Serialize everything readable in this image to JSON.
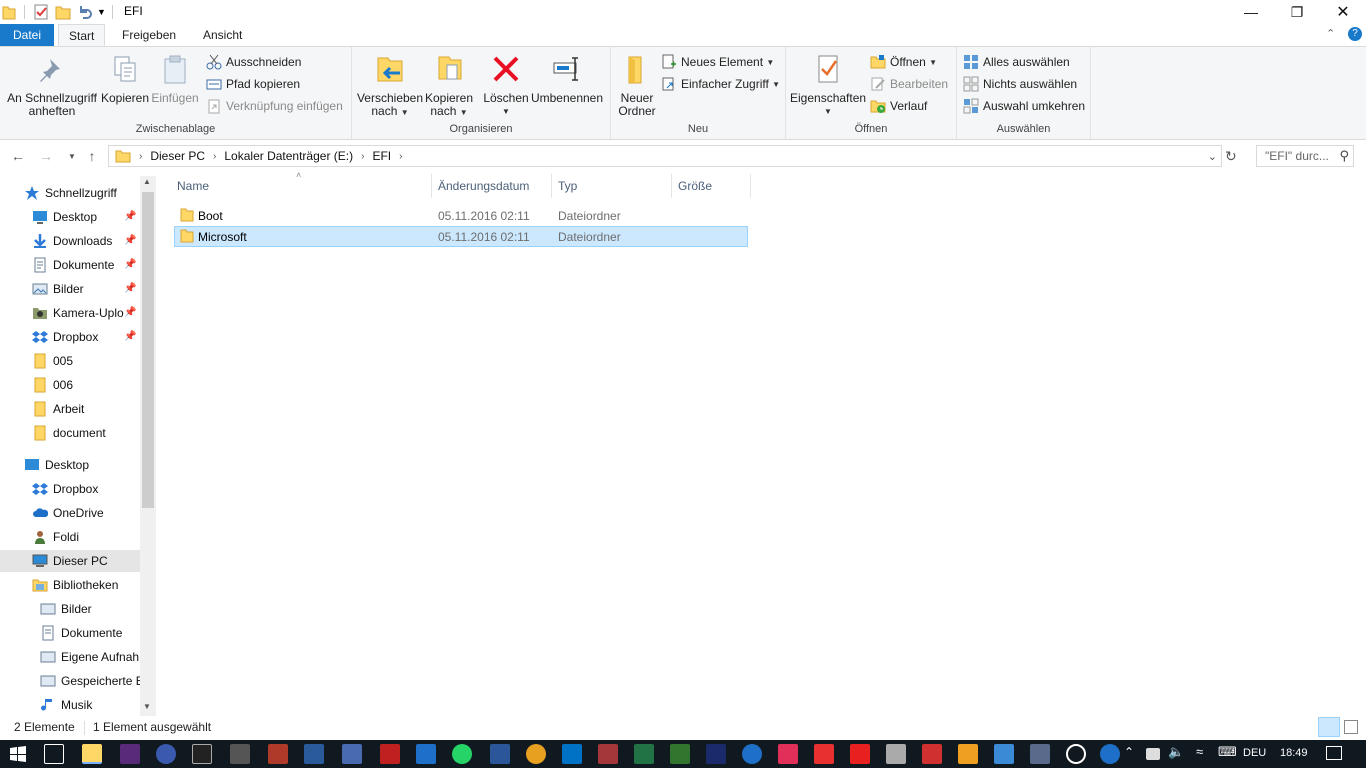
{
  "window": {
    "title": "EFI"
  },
  "tabs": {
    "file": "Datei",
    "start": "Start",
    "share": "Freigeben",
    "view": "Ansicht"
  },
  "ribbon": {
    "clipboard": {
      "group": "Zwischenablage",
      "pin_line1": "An Schnellzugriff",
      "pin_line2": "anheften",
      "copy": "Kopieren",
      "paste": "Einfügen",
      "cut": "Ausschneiden",
      "copy_path": "Pfad kopieren",
      "paste_shortcut": "Verknüpfung einfügen"
    },
    "organize": {
      "group": "Organisieren",
      "move_line1": "Verschieben",
      "move_line2": "nach",
      "copyto_line1": "Kopieren",
      "copyto_line2": "nach",
      "delete": "Löschen",
      "rename": "Umbenennen"
    },
    "new": {
      "group": "Neu",
      "folder_line1": "Neuer",
      "folder_line2": "Ordner",
      "new_item": "Neues Element",
      "easy_access": "Einfacher Zugriff"
    },
    "open": {
      "group": "Öffnen",
      "properties": "Eigenschaften",
      "open": "Öffnen",
      "edit": "Bearbeiten",
      "history": "Verlauf"
    },
    "select": {
      "group": "Auswählen",
      "select_all": "Alles auswählen",
      "select_none": "Nichts auswählen",
      "invert": "Auswahl umkehren"
    }
  },
  "address": {
    "crumbs": [
      "Dieser PC",
      "Lokaler Datenträger (E:)",
      "EFI"
    ],
    "search_placeholder": "\"EFI\" durc..."
  },
  "nav": {
    "quick_access": "Schnellzugriff",
    "items": [
      "Desktop",
      "Downloads",
      "Dokumente",
      "Bilder",
      "Kamera-Uplo",
      "Dropbox",
      "005",
      "006",
      "Arbeit",
      "document"
    ],
    "desktop": "Desktop",
    "tree": [
      "Dropbox",
      "OneDrive",
      "Foldi",
      "Dieser PC",
      "Bibliotheken"
    ],
    "libraries": [
      "Bilder",
      "Dokumente",
      "Eigene Aufnah",
      "Gespeicherte B",
      "Musik"
    ]
  },
  "columns": {
    "name": "Name",
    "date": "Änderungsdatum",
    "type": "Typ",
    "size": "Größe"
  },
  "files": [
    {
      "name": "Boot",
      "date": "05.11.2016 02:11",
      "type": "Dateiordner"
    },
    {
      "name": "Microsoft",
      "date": "05.11.2016 02:11",
      "type": "Dateiordner"
    }
  ],
  "status": {
    "count": "2 Elemente",
    "selected": "1 Element ausgewählt"
  },
  "taskbar": {
    "lang": "DEU",
    "time": "18:49"
  },
  "colors": {
    "accent": "#1979ca",
    "selection": "#cce8ff",
    "folder": "#ffd767"
  }
}
